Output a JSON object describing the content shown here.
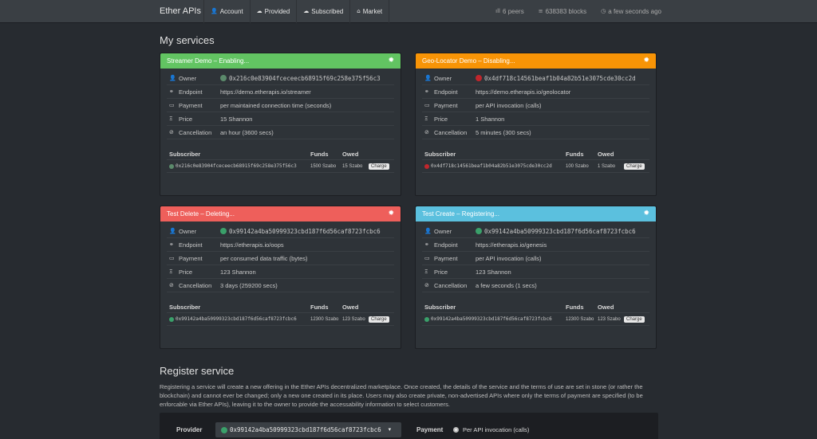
{
  "nav": {
    "brand": "Ether APIs",
    "items": [
      {
        "icon": "user-icon",
        "glyph": "👤",
        "label": "Account"
      },
      {
        "icon": "cloud-upload-icon",
        "glyph": "☁",
        "label": "Provided"
      },
      {
        "icon": "cloud-download-icon",
        "glyph": "☁",
        "label": "Subscribed"
      },
      {
        "icon": "shopping-basket-icon",
        "glyph": "⌂",
        "label": "Market"
      }
    ],
    "peers": "6 peers",
    "blocks": "638383 blocks",
    "time": "a few seconds ago"
  },
  "my_services_title": "My services",
  "labels": {
    "owner": "Owner",
    "endpoint": "Endpoint",
    "payment": "Payment",
    "price": "Price",
    "cancellation": "Cancellation",
    "subscriber": "Subscriber",
    "funds": "Funds",
    "owed": "Owed",
    "charge": "Charge"
  },
  "services": [
    {
      "title": "Streamer Demo – Enabling...",
      "color": "#62c462",
      "owner": "0x216c0e83904fceceecb68915f69c258e375f56c3",
      "owner_dot": "#5b8a6b",
      "endpoint": "https://demo.etherapis.io/streamer",
      "payment": "per maintained connection time (seconds)",
      "price": "15 Shannon",
      "cancellation": "an hour (3600 secs)",
      "subscriber": "0x216c0e83904fceceecb68915f69c258e375f56c3",
      "funds": "1500 Szabo",
      "owed": "15 Szabo"
    },
    {
      "title": "Geo-Locator Demo – Disabling...",
      "color": "#f89406",
      "owner": "0x4df718c14561beaf1b04a82b51e3075cde30cc2d",
      "owner_dot": "#c0262c",
      "endpoint": "https://demo.etherapis.io/geolocator",
      "payment": "per API invocation (calls)",
      "price": "1 Shannon",
      "cancellation": "5 minutes (300 secs)",
      "subscriber": "0x4df718c14561beaf1b04a82b51e3075cde30cc2d",
      "funds": "100 Szabo",
      "owed": "1 Szabo"
    },
    {
      "title": "Test Delete – Deleting...",
      "color": "#ee5f5b",
      "owner": "0x99142a4ba50999323cbd187f6d56caf8723fcbc6",
      "owner_dot": "#3aa06a",
      "endpoint": "https://etherapis.io/oops",
      "payment": "per consumed data traffic (bytes)",
      "price": "123 Shannon",
      "cancellation": "3 days (259200 secs)",
      "subscriber": "0x99142a4ba50999323cbd187f6d56caf8723fcbc6",
      "funds": "12300 Szabo",
      "owed": "123 Szabo"
    },
    {
      "title": "Test Create – Registering...",
      "color": "#5bc0de",
      "owner": "0x99142a4ba50999323cbd187f6d56caf8723fcbc6",
      "owner_dot": "#3aa06a",
      "endpoint": "https://etherapis.io/genesis",
      "payment": "per API invocation (calls)",
      "price": "123 Shannon",
      "cancellation": "a few seconds (1 secs)",
      "subscriber": "0x99142a4ba50999323cbd187f6d56caf8723fcbc6",
      "funds": "12300 Szabo",
      "owed": "123 Szabo"
    }
  ],
  "register": {
    "title": "Register service",
    "description": "Registering a service will create a new offering in the Ether APIs decentralized marketplace. Once created, the details of the service and the terms of use are set in stone (or rather the blockchain) and cannot ever be changed; only a new one created in its place. Users may also create private, non-advertised APIs where only the terms of payment are specified (to be enforcable via Ether APIs), leaving it to the owner to provide the accessability information to select customers.",
    "provider_label": "Provider",
    "provider_value": "0x99142a4ba50999323cbd187f6d56caf8723fcbc6",
    "payment_label": "Payment",
    "payment_option": "Per API invocation (calls)"
  }
}
